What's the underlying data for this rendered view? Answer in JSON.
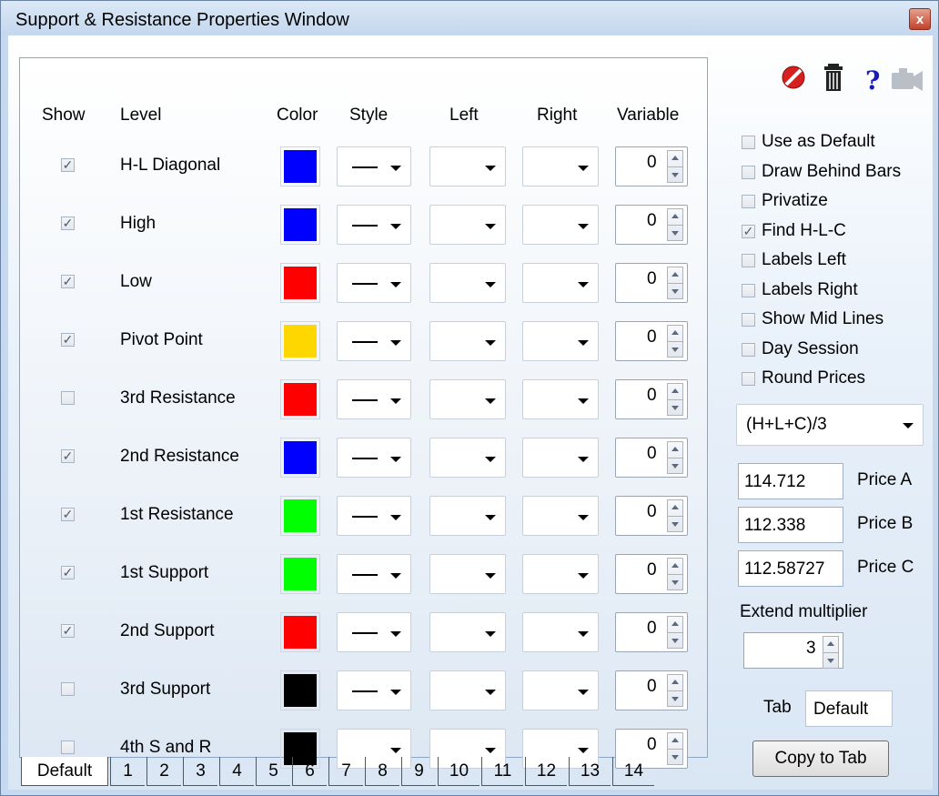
{
  "window": {
    "title": "Support & Resistance Properties Window",
    "close_glyph": "x"
  },
  "headers": {
    "show": "Show",
    "level": "Level",
    "color": "Color",
    "style": "Style",
    "left": "Left",
    "right": "Right",
    "variable": "Variable"
  },
  "rows": [
    {
      "checked": true,
      "label": "H-L Diagonal",
      "color": "#0000ff",
      "style_line": true,
      "variable": "0"
    },
    {
      "checked": true,
      "label": "High",
      "color": "#0000ff",
      "style_line": true,
      "variable": "0"
    },
    {
      "checked": true,
      "label": "Low",
      "color": "#ff0000",
      "style_line": true,
      "variable": "0"
    },
    {
      "checked": true,
      "label": "Pivot Point",
      "color": "#ffd700",
      "style_line": true,
      "variable": "0"
    },
    {
      "checked": false,
      "label": "3rd Resistance",
      "color": "#ff0000",
      "style_line": true,
      "variable": "0"
    },
    {
      "checked": true,
      "label": "2nd Resistance",
      "color": "#0000ff",
      "style_line": true,
      "variable": "0"
    },
    {
      "checked": true,
      "label": "1st Resistance",
      "color": "#00ff00",
      "style_line": true,
      "variable": "0"
    },
    {
      "checked": true,
      "label": "1st Support",
      "color": "#00ff00",
      "style_line": true,
      "variable": "0"
    },
    {
      "checked": true,
      "label": "2nd Support",
      "color": "#ff0000",
      "style_line": true,
      "variable": "0"
    },
    {
      "checked": false,
      "label": "3rd Support",
      "color": "#000000",
      "style_line": true,
      "variable": "0"
    },
    {
      "checked": false,
      "label": "4th S and R",
      "color": "#000000",
      "style_line": false,
      "variable": "0"
    }
  ],
  "tabs": [
    "Default",
    "1",
    "2",
    "3",
    "4",
    "5",
    "6",
    "7",
    "8",
    "9",
    "10",
    "11",
    "12",
    "13",
    "14"
  ],
  "active_tab": "Default",
  "icons": [
    "no-entry-icon",
    "trash-icon",
    "help-icon",
    "camera-icon"
  ],
  "options": [
    {
      "label": "Use as Default",
      "checked": false
    },
    {
      "label": "Draw Behind Bars",
      "checked": false
    },
    {
      "label": "Privatize",
      "checked": false
    },
    {
      "label": "Find H-L-C",
      "checked": true
    },
    {
      "label": "Labels Left",
      "checked": false
    },
    {
      "label": "Labels Right",
      "checked": false
    },
    {
      "label": "Show Mid Lines",
      "checked": false
    },
    {
      "label": "Day Session",
      "checked": false
    },
    {
      "label": "Round Prices",
      "checked": false
    }
  ],
  "formula": "(H+L+C)/3",
  "prices": [
    {
      "value": "114.712",
      "label": "Price A"
    },
    {
      "value": "112.338",
      "label": "Price B"
    },
    {
      "value": "112.58727",
      "label": "Price C"
    }
  ],
  "extend": {
    "label": "Extend multiplier",
    "value": "3"
  },
  "tab_field": {
    "label": "Tab",
    "value": "Default"
  },
  "copy_button": "Copy to Tab"
}
